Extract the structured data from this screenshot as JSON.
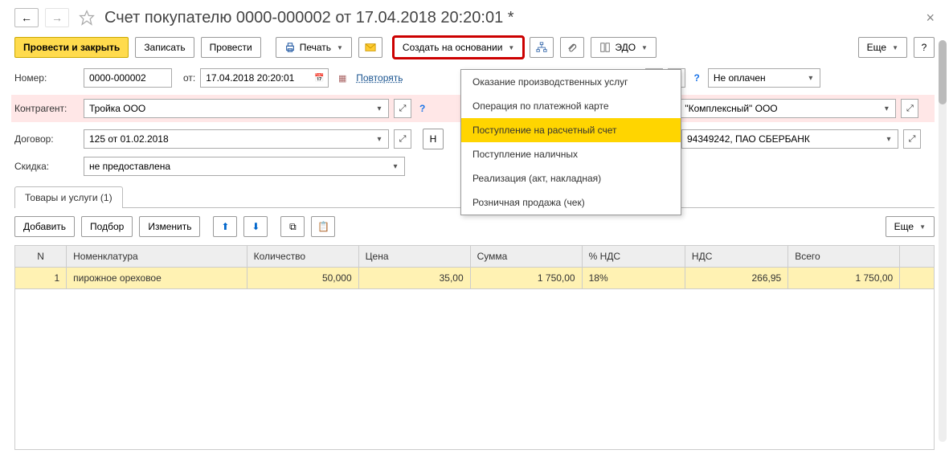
{
  "title": "Счет покупателю 0000-000002 от 17.04.2018 20:20:01 *",
  "toolbar": {
    "main_action": "Провести и закрыть",
    "save": "Записать",
    "post": "Провести",
    "print": "Печать",
    "create_based": "Создать на основании",
    "edo": "ЭДО",
    "more": "Еще",
    "help": "?"
  },
  "fields": {
    "number_lbl": "Номер:",
    "number": "0000-000002",
    "date_lbl": "от:",
    "date": "17.04.2018 20:20:01",
    "repeat": "Повторять",
    "status": "Не оплачен",
    "counterparty_lbl": "Контрагент:",
    "counterparty": "Тройка ООО",
    "org_partial": "\"Комплексный\" ООО",
    "contract_lbl": "Договор:",
    "contract": "125 от 01.02.2018",
    "bank_partial": "94349242, ПАО СБЕРБАНК",
    "discount_lbl": "Скидка:",
    "discount": "не предоставлена"
  },
  "dropdown": {
    "items": [
      "Оказание производственных услуг",
      "Операция по платежной карте",
      "Поступление на расчетный счет",
      "Поступление наличных",
      "Реализация (акт, накладная)",
      "Розничная продажа (чек)"
    ]
  },
  "tab": "Товары и услуги (1)",
  "subtoolbar": {
    "add": "Добавить",
    "pick": "Подбор",
    "edit": "Изменить",
    "more": "Еще"
  },
  "grid": {
    "headers": [
      "N",
      "Номенклатура",
      "Количество",
      "Цена",
      "Сумма",
      "% НДС",
      "НДС",
      "Всего"
    ],
    "row": {
      "n": "1",
      "item": "пирожное ореховое",
      "qty": "50,000",
      "price": "35,00",
      "sum": "1 750,00",
      "vat_pct": "18%",
      "vat": "266,95",
      "total": "1 750,00"
    }
  }
}
